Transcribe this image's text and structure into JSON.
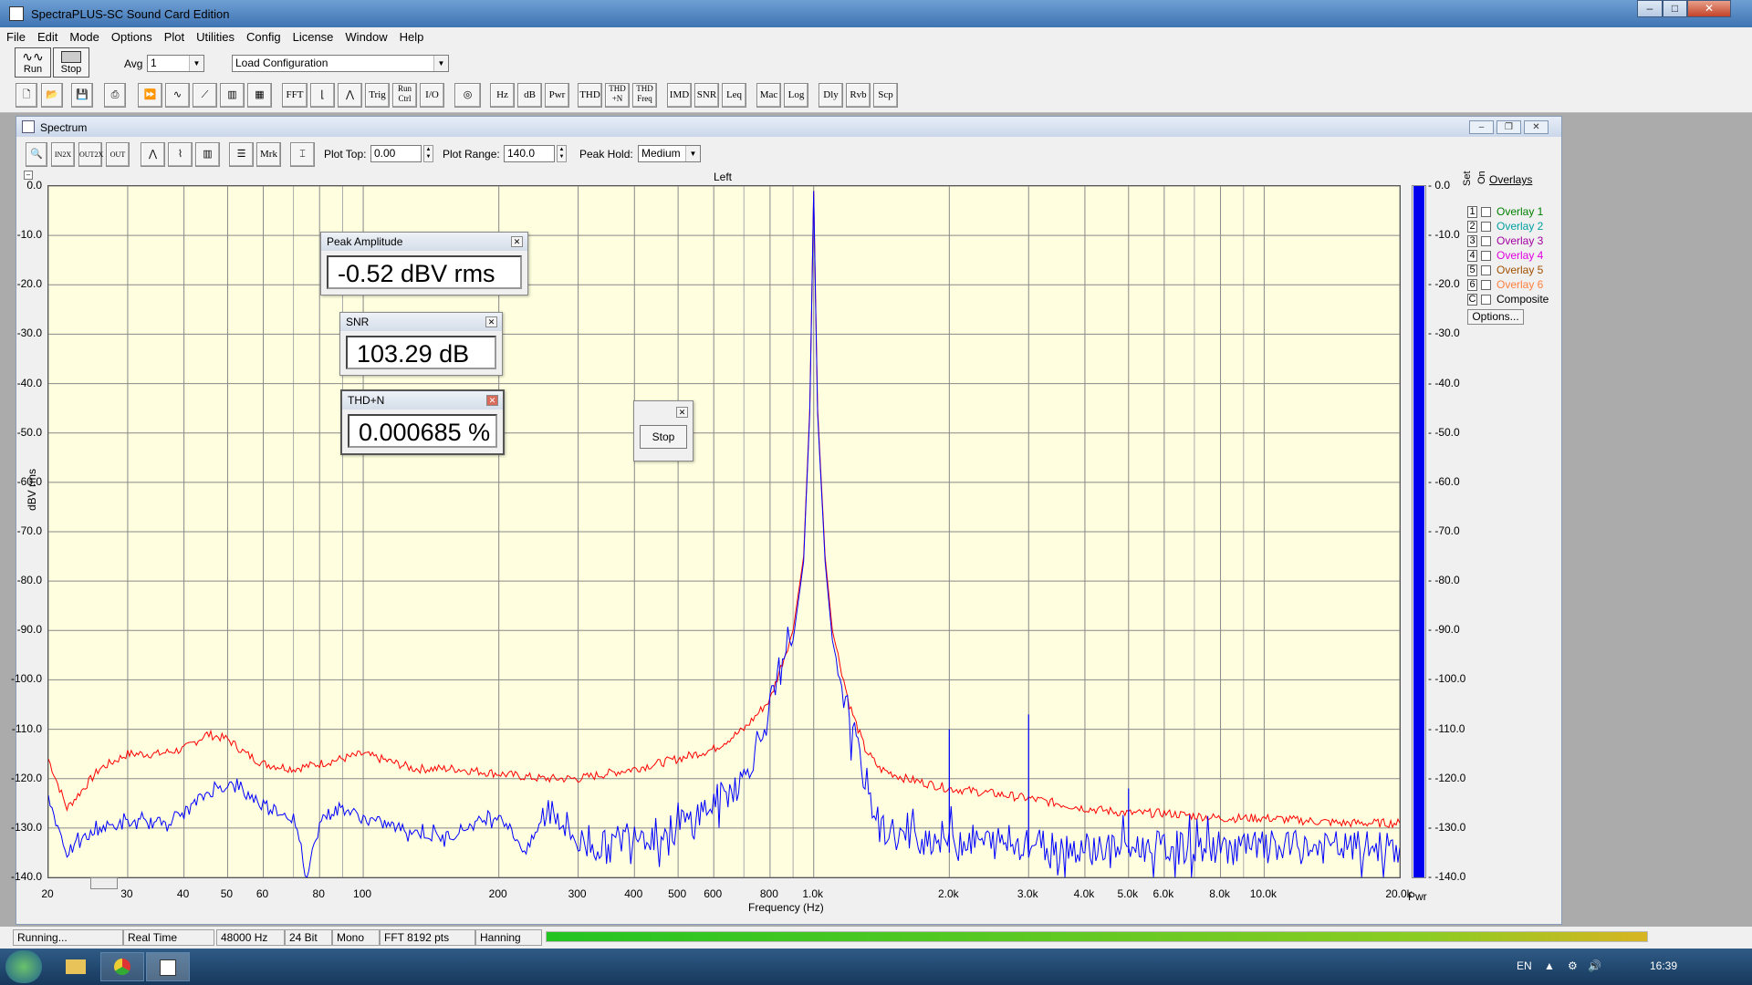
{
  "app": {
    "title": "SpectraPLUS-SC Sound Card Edition"
  },
  "menu": [
    "File",
    "Edit",
    "Mode",
    "Options",
    "Plot",
    "Utilities",
    "Config",
    "License",
    "Window",
    "Help"
  ],
  "toolbar1": {
    "run_label": "Run",
    "stop_label": "Stop",
    "avg_label": "Avg",
    "avg_value": "1",
    "config_value": "Load Configuration"
  },
  "toolbar2": {
    "buttons": [
      "FFT",
      "Trig",
      "Run Ctrl",
      "I/O",
      "Hz",
      "dB",
      "Pwr",
      "THD",
      "THD +N",
      "THD Freq",
      "IMD",
      "SNR",
      "Leq",
      "Mac",
      "Log",
      "Dly",
      "Rvb",
      "Scp"
    ]
  },
  "spectrum_window": {
    "title": "Spectrum",
    "mrk_label": "Mrk",
    "plot_top_label": "Plot Top:",
    "plot_top_value": "0.00",
    "plot_range_label": "Plot Range:",
    "plot_range_value": "140.0",
    "peak_hold_label": "Peak Hold:",
    "peak_hold_value": "Medium",
    "channel_label": "Left"
  },
  "chart_data": {
    "type": "line",
    "title": "Left",
    "xlabel": "Frequency (Hz)",
    "ylabel": "dBV rms",
    "x_scale": "log",
    "xlim": [
      20,
      20000
    ],
    "ylim": [
      -140,
      0
    ],
    "x_ticks": [
      "20",
      "30",
      "40",
      "50",
      "60",
      "80",
      "100",
      "200",
      "300",
      "400",
      "500",
      "600",
      "800",
      "1.0k",
      "2.0k",
      "3.0k",
      "4.0k",
      "5.0k",
      "6.0k",
      "8.0k",
      "10.0k",
      "20.0k"
    ],
    "y_ticks": [
      "0.0",
      "-10.0",
      "-20.0",
      "-30.0",
      "-40.0",
      "-50.0",
      "-60.0",
      "-70.0",
      "-80.0",
      "-90.0",
      "-100.0",
      "-110.0",
      "-120.0",
      "-130.0",
      "-140.0"
    ],
    "grid": true,
    "series": [
      {
        "color": "#ff0000",
        "points": [
          [
            20,
            -116
          ],
          [
            22,
            -126
          ],
          [
            26,
            -118
          ],
          [
            30,
            -115
          ],
          [
            35,
            -115
          ],
          [
            40,
            -114
          ],
          [
            45,
            -111
          ],
          [
            50,
            -112
          ],
          [
            55,
            -115
          ],
          [
            60,
            -117
          ],
          [
            70,
            -118
          ],
          [
            80,
            -117
          ],
          [
            100,
            -115
          ],
          [
            130,
            -118
          ],
          [
            160,
            -118
          ],
          [
            200,
            -119
          ],
          [
            250,
            -120
          ],
          [
            300,
            -120
          ],
          [
            400,
            -118
          ],
          [
            500,
            -116
          ],
          [
            600,
            -114
          ],
          [
            700,
            -110
          ],
          [
            800,
            -104
          ],
          [
            900,
            -90
          ],
          [
            950,
            -75
          ],
          [
            980,
            -45
          ],
          [
            1000,
            -1
          ],
          [
            1020,
            -45
          ],
          [
            1060,
            -75
          ],
          [
            1100,
            -90
          ],
          [
            1200,
            -105
          ],
          [
            1300,
            -114
          ],
          [
            1400,
            -118
          ],
          [
            1600,
            -120
          ],
          [
            2000,
            -122
          ],
          [
            2500,
            -123
          ],
          [
            3000,
            -124
          ],
          [
            4000,
            -126
          ],
          [
            5000,
            -127
          ],
          [
            6000,
            -127
          ],
          [
            8000,
            -128
          ],
          [
            10000,
            -128
          ],
          [
            15000,
            -129
          ],
          [
            20000,
            -129
          ]
        ]
      },
      {
        "color": "#0000ff",
        "points": [
          [
            20,
            -124
          ],
          [
            22,
            -135
          ],
          [
            26,
            -130
          ],
          [
            30,
            -129
          ],
          [
            35,
            -129
          ],
          [
            40,
            -127
          ],
          [
            45,
            -123
          ],
          [
            50,
            -121
          ],
          [
            55,
            -123
          ],
          [
            60,
            -125
          ],
          [
            70,
            -128
          ],
          [
            75,
            -140
          ],
          [
            80,
            -128
          ],
          [
            90,
            -126
          ],
          [
            100,
            -128
          ],
          [
            120,
            -130
          ],
          [
            150,
            -132
          ],
          [
            200,
            -127
          ],
          [
            230,
            -135
          ],
          [
            260,
            -125
          ],
          [
            300,
            -133
          ],
          [
            350,
            -134
          ],
          [
            400,
            -130
          ],
          [
            450,
            -132
          ],
          [
            500,
            -130
          ],
          [
            600,
            -125
          ],
          [
            700,
            -120
          ],
          [
            800,
            -106
          ],
          [
            900,
            -92
          ],
          [
            950,
            -76
          ],
          [
            980,
            -46
          ],
          [
            1000,
            -1
          ],
          [
            1020,
            -46
          ],
          [
            1060,
            -76
          ],
          [
            1100,
            -92
          ],
          [
            1200,
            -108
          ],
          [
            1300,
            -120
          ],
          [
            1400,
            -130
          ],
          [
            1600,
            -132
          ],
          [
            2000,
            -132
          ],
          [
            2500,
            -133
          ],
          [
            3000,
            -133
          ],
          [
            4000,
            -134
          ],
          [
            5000,
            -134
          ],
          [
            6000,
            -134
          ],
          [
            8000,
            -134
          ],
          [
            10000,
            -134
          ],
          [
            15000,
            -134
          ],
          [
            20000,
            -134
          ]
        ]
      }
    ],
    "spurs": [
      [
        2000,
        -110
      ],
      [
        3000,
        -107
      ],
      [
        5000,
        -122
      ]
    ]
  },
  "level_meter": {
    "label": "Pwr",
    "fill_fraction": 1.0,
    "ticks": [
      "0.0",
      "-10.0",
      "-20.0",
      "-30.0",
      "-40.0",
      "-50.0",
      "-60.0",
      "-70.0",
      "-80.0",
      "-90.0",
      "-100.0",
      "-110.0",
      "-120.0",
      "-130.0",
      "-140.0"
    ]
  },
  "overlays": {
    "title": "Overlays",
    "set_label": "Set",
    "on_label": "On",
    "items": [
      {
        "num": "1",
        "label": "Overlay 1",
        "color": "#008000"
      },
      {
        "num": "2",
        "label": "Overlay 2",
        "color": "#00a0a0"
      },
      {
        "num": "3",
        "label": "Overlay 3",
        "color": "#a000a0"
      },
      {
        "num": "4",
        "label": "Overlay 4",
        "color": "#e000e0"
      },
      {
        "num": "5",
        "label": "Overlay 5",
        "color": "#a05000"
      },
      {
        "num": "6",
        "label": "Overlay 6",
        "color": "#ff8040"
      },
      {
        "num": "C",
        "label": "Composite",
        "color": "#000000"
      }
    ],
    "options_label": "Options..."
  },
  "meters": {
    "peak": {
      "title": "Peak Amplitude",
      "value": "-0.52 dBV rms"
    },
    "snr": {
      "title": "SNR",
      "value": "103.29 dB"
    },
    "thd": {
      "title": "THD+N",
      "value": "0.000685 %"
    },
    "stop_button": "Stop"
  },
  "status": {
    "cells": [
      "Running...",
      "Real Time",
      "48000 Hz",
      "24 Bit",
      "Mono",
      "FFT 8192 pts",
      "Hanning"
    ],
    "progress": 1.0
  },
  "taskbar": {
    "lang": "EN",
    "time": "16:39"
  }
}
